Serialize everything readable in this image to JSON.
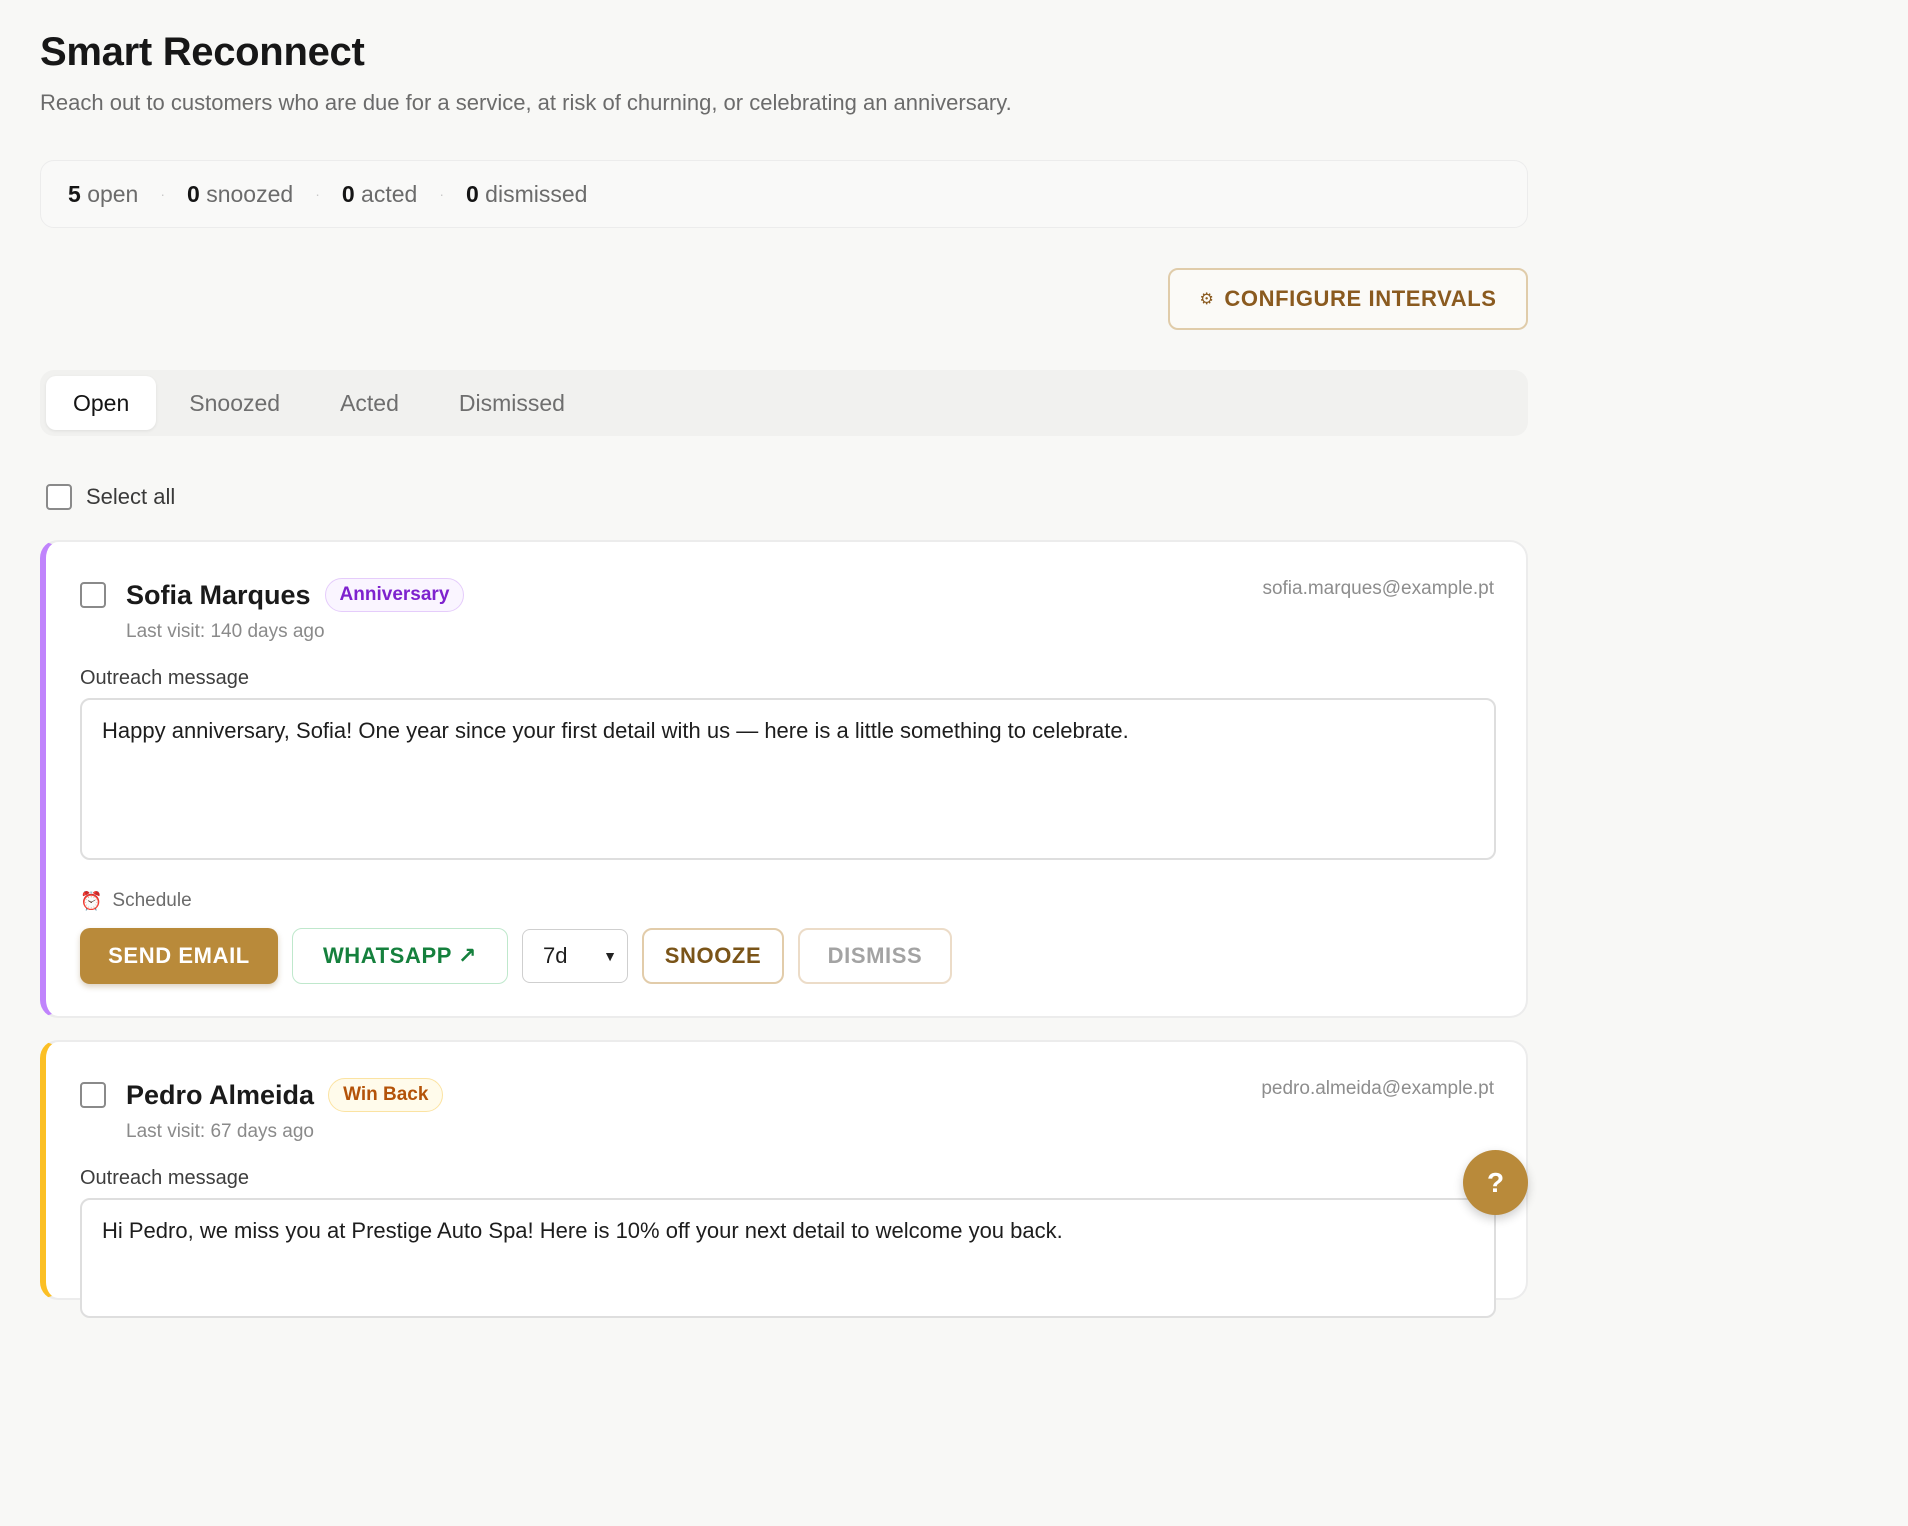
{
  "header": {
    "title": "Smart Reconnect",
    "subtitle": "Reach out to customers who are due for a service, at risk of churning, or celebrating an anniversary."
  },
  "stats": {
    "open_count": "5",
    "open_label": "open",
    "snoozed_count": "0",
    "snoozed_label": "snoozed",
    "acted_count": "0",
    "acted_label": "acted",
    "dismissed_count": "0",
    "dismissed_label": "dismissed",
    "separator": "·"
  },
  "toolbar": {
    "config_icon": "gear-icon",
    "config_glyph": "⚙",
    "config_label": "CONFIGURE INTERVALS"
  },
  "tabs": [
    {
      "label": "Open",
      "active": true
    },
    {
      "label": "Snoozed",
      "active": false
    },
    {
      "label": "Acted",
      "active": false
    },
    {
      "label": "Dismissed",
      "active": false
    }
  ],
  "select_all_label": "Select all",
  "cards": [
    {
      "name": "Sofia Marques",
      "badge": "Anniversary",
      "badge_color": "#7e22ce",
      "accent_color": "#c084fc",
      "email": "sofia.marques@example.pt",
      "last_visit": "Last visit: 140 days ago",
      "message_label": "Outreach message",
      "message": "Happy anniversary, Sofia! One year since your first detail with us — here is a little something to celebrate.",
      "schedule_icon": "alarm-clock-icon",
      "schedule_glyph": "⏰",
      "schedule_label": "Schedule",
      "send_label": "SEND EMAIL",
      "whatsapp_label": "WHATSAPP",
      "whatsapp_icon": "external-link-icon",
      "whatsapp_glyph": "↗",
      "snooze_value": "7d",
      "snooze_label": "SNOOZE",
      "dismiss_label": "DISMISS"
    },
    {
      "name": "Pedro Almeida",
      "badge": "Win Back",
      "badge_color": "#b45309",
      "accent_color": "#fbbf24",
      "email": "pedro.almeida@example.pt",
      "last_visit": "Last visit: 67 days ago",
      "message_label": "Outreach message",
      "message": "Hi Pedro, we miss you at Prestige Auto Spa! Here is 10% off your next detail to welcome you back."
    }
  ],
  "help": {
    "label": "?",
    "icon": "help-icon"
  }
}
